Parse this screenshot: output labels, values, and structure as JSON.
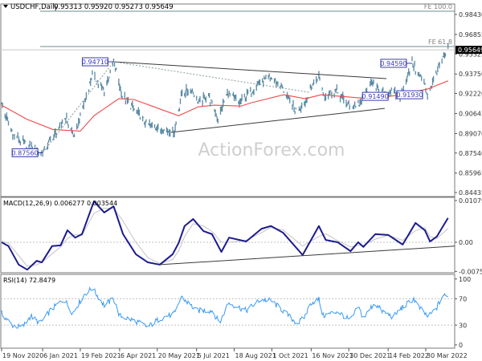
{
  "header": {
    "arrow_icon": "triangle-down-icon",
    "symbol": "USDCHF,Daily",
    "ohlc": "0.95313 0.95920 0.95273 0.95649"
  },
  "watermark": "ActionForex.com",
  "colors": {
    "price_bars": "#5b8aa3",
    "moving_average": "#f04848",
    "macd_line": "#1c1c8e",
    "macd_signal": "#c4c4c4",
    "rsi_line": "#3a9af5",
    "label_box": "#3a3ab8",
    "fe_lines": "#6e8c8c",
    "current_price_tag": "#000000"
  },
  "chart_data": [
    {
      "type": "ohlc",
      "panel": "price",
      "title": "USDCHF,Daily",
      "y_ticks": [
        "0.98430",
        "0.96855",
        "0.95325",
        "0.93750",
        "0.92220",
        "0.90645",
        "0.89070",
        "0.87540",
        "0.85965",
        "0.84435"
      ],
      "ylim": [
        0.8412,
        0.9925
      ],
      "current_price": "0.95649",
      "close": [
        [
          "2020-11-19",
          0.913
        ],
        [
          "2020-12-03",
          0.8894
        ],
        [
          "2020-12-18",
          0.8824
        ],
        [
          "2021-01-06",
          0.8756
        ],
        [
          "2021-02-02",
          0.9034
        ],
        [
          "2021-02-12",
          0.8875
        ],
        [
          "2021-03-05",
          0.9365
        ],
        [
          "2021-03-19",
          0.9238
        ],
        [
          "2021-03-30",
          0.9471
        ],
        [
          "2021-04-09",
          0.9206
        ],
        [
          "2021-05-07",
          0.899
        ],
        [
          "2021-05-24",
          0.8939
        ],
        [
          "2021-06-09",
          0.8926
        ],
        [
          "2021-06-18",
          0.9225
        ],
        [
          "2021-06-30",
          0.9257
        ],
        [
          "2021-07-07",
          0.9149
        ],
        [
          "2021-07-19",
          0.9206
        ],
        [
          "2021-07-30",
          0.9021
        ],
        [
          "2021-08-10",
          0.9225
        ],
        [
          "2021-08-24",
          0.9149
        ],
        [
          "2021-09-16",
          0.9302
        ],
        [
          "2021-09-30",
          0.934
        ],
        [
          "2021-10-12",
          0.9276
        ],
        [
          "2021-10-29",
          0.9085
        ],
        [
          "2021-11-09",
          0.9149
        ],
        [
          "2021-11-18",
          0.9302
        ],
        [
          "2021-11-25",
          0.9365
        ],
        [
          "2021-12-01",
          0.9212
        ],
        [
          "2021-12-16",
          0.9238
        ],
        [
          "2021-12-31",
          0.9117
        ],
        [
          "2022-01-14",
          0.9149
        ],
        [
          "2022-01-28",
          0.9333
        ],
        [
          "2022-02-04",
          0.9212
        ],
        [
          "2022-02-17",
          0.9238
        ],
        [
          "2022-02-28",
          0.9193
        ],
        [
          "2022-03-14",
          0.9459
        ],
        [
          "2022-03-28",
          0.9302
        ],
        [
          "2022-04-01",
          0.9206
        ],
        [
          "2022-04-14",
          0.9429
        ],
        [
          "2022-04-25",
          0.9565
        ]
      ],
      "moving_average": [
        [
          "2020-11-19",
          0.913
        ],
        [
          "2020-12-18",
          0.9021
        ],
        [
          "2021-01-18",
          0.8939
        ],
        [
          "2021-02-19",
          0.8926
        ],
        [
          "2021-03-07",
          0.9047
        ],
        [
          "2021-04-05",
          0.9181
        ],
        [
          "2021-04-23",
          0.9174
        ],
        [
          "2021-05-24",
          0.9098
        ],
        [
          "2021-06-14",
          0.9047
        ],
        [
          "2021-07-07",
          0.9117
        ],
        [
          "2021-07-26",
          0.913
        ],
        [
          "2021-08-26",
          0.9123
        ],
        [
          "2021-09-07",
          0.9149
        ],
        [
          "2021-10-15",
          0.9212
        ],
        [
          "2021-11-09",
          0.9181
        ],
        [
          "2021-11-28",
          0.9212
        ],
        [
          "2022-01-23",
          0.9181
        ],
        [
          "2022-02-23",
          0.9206
        ],
        [
          "2022-04-01",
          0.9257
        ],
        [
          "2022-04-25",
          0.9321
        ]
      ],
      "fib_levels": [
        {
          "label": "FE 100.0",
          "value": 0.9868
        },
        {
          "label": "FE 61.8",
          "value": 0.9591
        }
      ],
      "price_labels": [
        {
          "text": "0.94710",
          "date": "2021-03-30",
          "value": 0.9471
        },
        {
          "text": "0.87560",
          "date": "2021-01-06",
          "value": 0.8756
        },
        {
          "text": "0.94590",
          "date": "2022-03-14",
          "value": 0.9459
        },
        {
          "text": "0.91490",
          "date": "2022-01-14",
          "value": 0.9149
        },
        {
          "text": "0.91930",
          "date": "2022-02-28",
          "value": 0.9193
        }
      ],
      "trendlines": [
        {
          "style": "solid",
          "from": [
            "2021-03-30",
            0.9471
          ],
          "to": [
            "2022-02-12",
            0.9339
          ]
        },
        {
          "style": "solid",
          "from": [
            "2021-06-05",
            0.8916
          ],
          "to": [
            "2022-02-10",
            0.9105
          ]
        },
        {
          "style": "dotted",
          "from": [
            "2021-01-06",
            0.8756
          ],
          "to": [
            "2021-03-30",
            0.9471
          ]
        },
        {
          "style": "dotted",
          "from": [
            "2021-03-30",
            0.9471
          ],
          "to": [
            "2021-11-14",
            0.9231
          ]
        }
      ]
    },
    {
      "type": "line",
      "panel": "macd",
      "label": "MACD(12,26,9) 0.006277 0.003544",
      "y_ticks": [
        "0.010797",
        "0.00",
        "-0.007548"
      ],
      "ylim": [
        -0.00789,
        0.01183
      ],
      "dates": [
        "2020-11-19",
        "2020-11-27",
        "2020-12-09",
        "2020-12-19",
        "2020-12-30",
        "2021-01-05",
        "2021-01-17",
        "2021-01-27",
        "2021-02-04",
        "2021-02-13",
        "2021-02-21",
        "2021-03-07",
        "2021-03-19",
        "2021-03-30",
        "2021-04-10",
        "2021-04-25",
        "2021-05-09",
        "2021-05-23",
        "2021-06-07",
        "2021-06-14",
        "2021-06-21",
        "2021-07-01",
        "2021-07-13",
        "2021-07-23",
        "2021-08-03",
        "2021-08-12",
        "2021-09-01",
        "2021-09-19",
        "2021-09-30",
        "2021-10-14",
        "2021-11-06",
        "2021-11-25",
        "2021-12-03",
        "2021-12-17",
        "2022-01-01",
        "2022-01-10",
        "2022-01-16",
        "2022-01-30",
        "2022-02-14",
        "2022-03-03",
        "2022-03-18",
        "2022-03-29",
        "2022-04-04",
        "2022-04-12",
        "2022-04-25"
      ],
      "series": [
        {
          "name": "MACD",
          "values": [
            0,
            -0.001,
            -0.0058,
            -0.0071,
            -0.0048,
            -0.0052,
            -0.001,
            -0.0008,
            0.0031,
            0.0012,
            0.0021,
            0.0106,
            0.0077,
            0.0093,
            0.0021,
            -0.0031,
            -0.0052,
            -0.0058,
            -0.0031,
            -0.0002,
            0.0042,
            0.006,
            0.0029,
            0.0021,
            -0.0025,
            0.0012,
            0.0002,
            0.0035,
            0.0042,
            0.0025,
            -0.0033,
            0.0042,
            0.0006,
            0.0,
            -0.0023,
            0.0,
            -0.0012,
            0.0021,
            0.0019,
            -0.0006,
            0.005,
            0.0031,
            0.0002,
            0.0015,
            0.006277
          ]
        },
        {
          "name": "Signal",
          "values": [
            0.0003,
            -0.0002,
            -0.0035,
            -0.0062,
            -0.0058,
            -0.0052,
            -0.003,
            -0.0012,
            0.001,
            0.002,
            0.0018,
            0.0075,
            0.0088,
            0.0088,
            0.0055,
            0.0,
            -0.004,
            -0.0055,
            -0.0045,
            -0.0022,
            0.0015,
            0.0048,
            0.0042,
            0.0028,
            0.0,
            0.0,
            0.0005,
            0.0025,
            0.0038,
            0.0032,
            -0.001,
            0.0015,
            0.0022,
            0.0004,
            -0.0012,
            -0.0008,
            -0.0008,
            0.0008,
            0.0018,
            0.0005,
            0.003,
            0.0038,
            0.0015,
            0.001,
            0.003544
          ]
        }
      ],
      "reference_lines": [
        0
      ],
      "trendline": {
        "from": [
          "2021-05-23",
          -0.0058
        ],
        "to": [
          "2022-05-03",
          -0.001
        ]
      }
    },
    {
      "type": "line",
      "panel": "rsi",
      "label": "RSI(14) 72.8479",
      "y_ticks": [
        "100",
        "70",
        "30",
        "0"
      ],
      "ylim": [
        -5,
        107
      ],
      "reference_lines": [
        70,
        30
      ],
      "dates": [
        "2020-11-19",
        "2020-12-01",
        "2020-12-13",
        "2020-12-23",
        "2021-01-03",
        "2021-01-15",
        "2021-01-31",
        "2021-02-10",
        "2021-02-24",
        "2021-03-05",
        "2021-03-19",
        "2021-03-30",
        "2021-04-06",
        "2021-04-25",
        "2021-05-09",
        "2021-05-23",
        "2021-06-10",
        "2021-06-17",
        "2021-07-05",
        "2021-07-23",
        "2021-08-01",
        "2021-08-11",
        "2021-09-01",
        "2021-09-18",
        "2021-09-30",
        "2021-10-14",
        "2021-10-31",
        "2021-11-08",
        "2021-11-16",
        "2021-11-25",
        "2021-11-30",
        "2021-12-17",
        "2022-01-01",
        "2022-01-10",
        "2022-01-16",
        "2022-01-29",
        "2022-02-06",
        "2022-02-20",
        "2022-02-28",
        "2022-03-16",
        "2022-03-22",
        "2022-04-02",
        "2022-04-12",
        "2022-04-19",
        "2022-04-25"
      ],
      "values": [
        48,
        30,
        26,
        44,
        32,
        52,
        70,
        48,
        77,
        86,
        60,
        70,
        44,
        36,
        27,
        40,
        48,
        73,
        52,
        52,
        33,
        64,
        52,
        69,
        67,
        52,
        32,
        42,
        64,
        69,
        44,
        51,
        36,
        58,
        40,
        64,
        52,
        42,
        54,
        70,
        57,
        42,
        57,
        75,
        72.85
      ]
    }
  ],
  "x_ticks": [
    "19 Nov 2020",
    "6 Jan 2021",
    "19 Feb 2021",
    "6 Apr 2021",
    "20 May 2021",
    "5 Jul 2021",
    "18 Aug 2021",
    "1 Oct 2021",
    "16 Nov 2021",
    "30 Dec 2021",
    "14 Feb 2022",
    "30 Mar 2022"
  ]
}
